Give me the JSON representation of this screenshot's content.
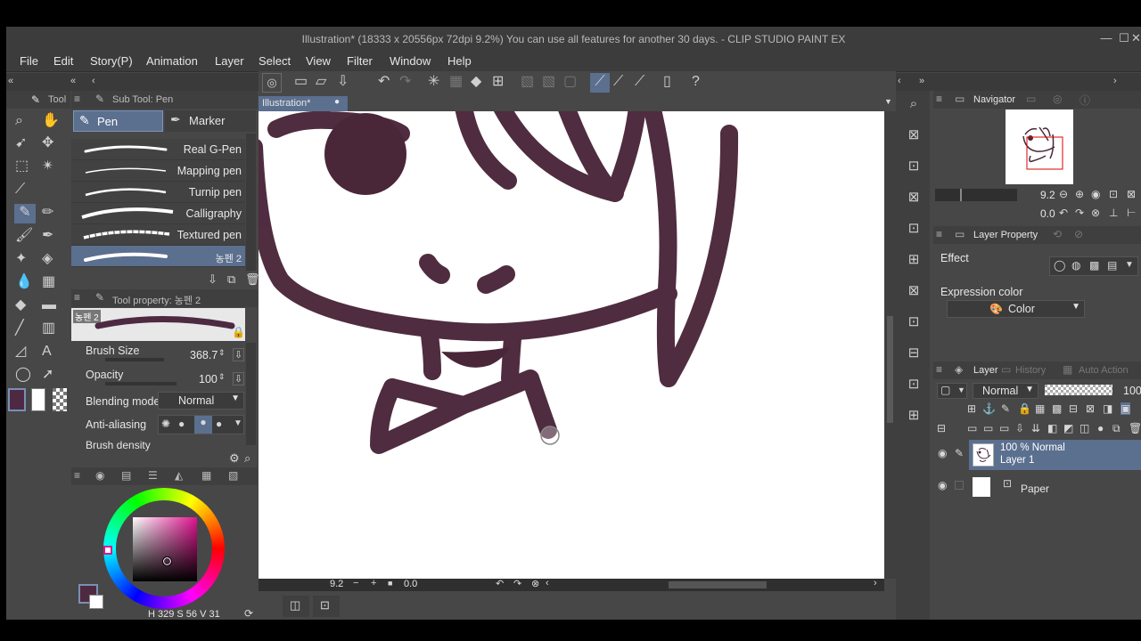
{
  "window": {
    "title": "Illustration* (18333 x 20556px 72dpi 9.2%)  You can use all features for another 30 days. - CLIP STUDIO PAINT EX",
    "minimize": "—",
    "maximize": "☐",
    "close": "✕"
  },
  "menu": [
    "File",
    "Edit",
    "Story(P)",
    "Animation",
    "Layer",
    "Select",
    "View",
    "Filter",
    "Window",
    "Help"
  ],
  "tool_panel": {
    "title": "Tool"
  },
  "sub_tool": {
    "title": "Sub Tool: Pen",
    "tabs": [
      "Pen",
      "Marker"
    ],
    "brushes": [
      "Real G-Pen",
      "Mapping pen",
      "Turnip pen",
      "Calligraphy",
      "Textured pen",
      "농펜 2"
    ]
  },
  "tool_property": {
    "title": "Tool property: 농펜 2",
    "preview_name": "농펜 2",
    "brush_size_label": "Brush Size",
    "brush_size_value": "368.7",
    "opacity_label": "Opacity",
    "opacity_value": "100",
    "blending_label": "Blending mode",
    "blending_value": "Normal",
    "antialias_label": "Anti-aliasing",
    "density_label": "Brush density"
  },
  "color": {
    "main": "#4e2a42",
    "sub": "#ffffff",
    "readout": "H 329 S 56 V 31"
  },
  "canvas": {
    "tab": "Illustration*",
    "zoom": "9.2",
    "rotation": "0.0",
    "stroke_color": "#4a2639"
  },
  "navigator": {
    "title": "Navigator",
    "zoom": "9.2",
    "rotation": "0.0"
  },
  "layer_property": {
    "title": "Layer Property",
    "effect_label": "Effect",
    "expression_label": "Expression color",
    "expression_value": "Color"
  },
  "layer_panel": {
    "tabs": [
      "Layer",
      "History",
      "Auto Action"
    ],
    "blend_mode": "Normal",
    "opacity": "100",
    "layers": [
      {
        "line1": "100 % Normal",
        "line2": "Layer 1"
      },
      {
        "line1": "Paper",
        "line2": ""
      }
    ]
  }
}
